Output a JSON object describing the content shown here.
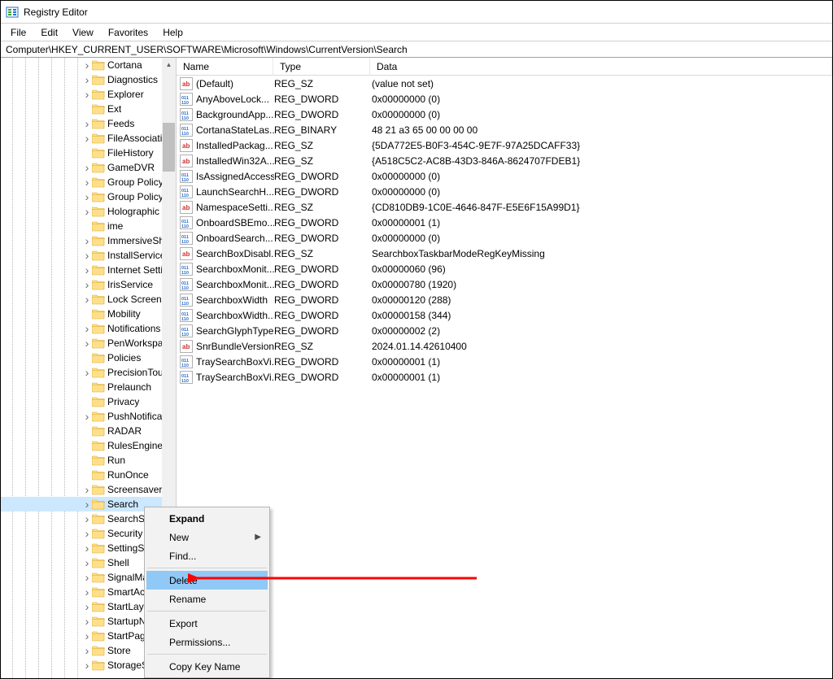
{
  "title": "Registry Editor",
  "menus": {
    "file": "File",
    "edit": "Edit",
    "view": "View",
    "favorites": "Favorites",
    "help": "Help"
  },
  "address": "Computer\\HKEY_CURRENT_USER\\SOFTWARE\\Microsoft\\Windows\\CurrentVersion\\Search",
  "columns": {
    "name": "Name",
    "type": "Type",
    "data": "Data"
  },
  "tree": [
    {
      "label": "Cortana",
      "exp": true,
      "depth": 6
    },
    {
      "label": "Diagnostics",
      "exp": true,
      "depth": 6
    },
    {
      "label": "Explorer",
      "exp": true,
      "depth": 6
    },
    {
      "label": "Ext",
      "exp": false,
      "depth": 6
    },
    {
      "label": "Feeds",
      "exp": true,
      "depth": 6
    },
    {
      "label": "FileAssociations",
      "exp": true,
      "depth": 6
    },
    {
      "label": "FileHistory",
      "exp": false,
      "depth": 6
    },
    {
      "label": "GameDVR",
      "exp": true,
      "depth": 6
    },
    {
      "label": "Group Policy",
      "exp": true,
      "depth": 6
    },
    {
      "label": "Group Policy",
      "exp": true,
      "depth": 6
    },
    {
      "label": "Holographic",
      "exp": true,
      "depth": 6
    },
    {
      "label": "ime",
      "exp": false,
      "depth": 6
    },
    {
      "label": "ImmersiveShell",
      "exp": true,
      "depth": 6
    },
    {
      "label": "InstallService",
      "exp": true,
      "depth": 6
    },
    {
      "label": "Internet Settings",
      "exp": true,
      "depth": 6
    },
    {
      "label": "IrisService",
      "exp": true,
      "depth": 6
    },
    {
      "label": "Lock Screen",
      "exp": true,
      "depth": 6
    },
    {
      "label": "Mobility",
      "exp": false,
      "depth": 6
    },
    {
      "label": "Notifications",
      "exp": true,
      "depth": 6
    },
    {
      "label": "PenWorkspace",
      "exp": true,
      "depth": 6
    },
    {
      "label": "Policies",
      "exp": false,
      "depth": 6
    },
    {
      "label": "PrecisionTouchPad",
      "exp": true,
      "depth": 6
    },
    {
      "label": "Prelaunch",
      "exp": false,
      "depth": 6
    },
    {
      "label": "Privacy",
      "exp": false,
      "depth": 6
    },
    {
      "label": "PushNotifications",
      "exp": true,
      "depth": 6
    },
    {
      "label": "RADAR",
      "exp": false,
      "depth": 6
    },
    {
      "label": "RulesEngine",
      "exp": false,
      "depth": 6
    },
    {
      "label": "Run",
      "exp": false,
      "depth": 6
    },
    {
      "label": "RunOnce",
      "exp": false,
      "depth": 6
    },
    {
      "label": "Screensavers",
      "exp": true,
      "depth": 6
    },
    {
      "label": "Search",
      "exp": true,
      "depth": 6,
      "selected": true
    },
    {
      "label": "SearchSettings",
      "exp": true,
      "depth": 6
    },
    {
      "label": "Security",
      "exp": true,
      "depth": 6
    },
    {
      "label": "SettingSync",
      "exp": true,
      "depth": 6
    },
    {
      "label": "Shell",
      "exp": true,
      "depth": 6
    },
    {
      "label": "SignalManager",
      "exp": true,
      "depth": 6
    },
    {
      "label": "SmartActionPlatform",
      "exp": true,
      "depth": 6
    },
    {
      "label": "StartLayout",
      "exp": true,
      "depth": 6
    },
    {
      "label": "StartupNotify",
      "exp": true,
      "depth": 6
    },
    {
      "label": "StartPage",
      "exp": true,
      "depth": 6
    },
    {
      "label": "Store",
      "exp": true,
      "depth": 6
    },
    {
      "label": "StorageSense",
      "exp": true,
      "depth": 6
    }
  ],
  "values": [
    {
      "icon": "sz",
      "name": "(Default)",
      "type": "REG_SZ",
      "data": "(value not set)"
    },
    {
      "icon": "dw",
      "name": "AnyAboveLock...",
      "type": "REG_DWORD",
      "data": "0x00000000 (0)"
    },
    {
      "icon": "dw",
      "name": "BackgroundApp...",
      "type": "REG_DWORD",
      "data": "0x00000000 (0)"
    },
    {
      "icon": "dw",
      "name": "CortanaStateLas...",
      "type": "REG_BINARY",
      "data": "48 21 a3 65 00 00 00 00"
    },
    {
      "icon": "sz",
      "name": "InstalledPackag...",
      "type": "REG_SZ",
      "data": "{5DA772E5-B0F3-454C-9E7F-97A25DCAFF33}"
    },
    {
      "icon": "sz",
      "name": "InstalledWin32A...",
      "type": "REG_SZ",
      "data": "{A518C5C2-AC8B-43D3-846A-8624707FDEB1}"
    },
    {
      "icon": "dw",
      "name": "IsAssignedAccess",
      "type": "REG_DWORD",
      "data": "0x00000000 (0)"
    },
    {
      "icon": "dw",
      "name": "LaunchSearchH...",
      "type": "REG_DWORD",
      "data": "0x00000000 (0)"
    },
    {
      "icon": "sz",
      "name": "NamespaceSetti...",
      "type": "REG_SZ",
      "data": "{CD810DB9-1C0E-4646-847F-E5E6F15A99D1}"
    },
    {
      "icon": "dw",
      "name": "OnboardSBEmo...",
      "type": "REG_DWORD",
      "data": "0x00000001 (1)"
    },
    {
      "icon": "dw",
      "name": "OnboardSearch...",
      "type": "REG_DWORD",
      "data": "0x00000000 (0)"
    },
    {
      "icon": "sz",
      "name": "SearchBoxDisabl...",
      "type": "REG_SZ",
      "data": "SearchboxTaskbarModeRegKeyMissing"
    },
    {
      "icon": "dw",
      "name": "SearchboxMonit...",
      "type": "REG_DWORD",
      "data": "0x00000060 (96)"
    },
    {
      "icon": "dw",
      "name": "SearchboxMonit...",
      "type": "REG_DWORD",
      "data": "0x00000780 (1920)"
    },
    {
      "icon": "dw",
      "name": "SearchboxWidth",
      "type": "REG_DWORD",
      "data": "0x00000120 (288)"
    },
    {
      "icon": "dw",
      "name": "SearchboxWidth...",
      "type": "REG_DWORD",
      "data": "0x00000158 (344)"
    },
    {
      "icon": "dw",
      "name": "SearchGlyphType",
      "type": "REG_DWORD",
      "data": "0x00000002 (2)"
    },
    {
      "icon": "sz",
      "name": "SnrBundleVersion",
      "type": "REG_SZ",
      "data": "2024.01.14.42610400"
    },
    {
      "icon": "dw",
      "name": "TraySearchBoxVi...",
      "type": "REG_DWORD",
      "data": "0x00000001 (1)"
    },
    {
      "icon": "dw",
      "name": "TraySearchBoxVi...",
      "type": "REG_DWORD",
      "data": "0x00000001 (1)"
    }
  ],
  "contextMenu": {
    "expand": "Expand",
    "new": "New",
    "find": "Find...",
    "delete": "Delete",
    "rename": "Rename",
    "export": "Export",
    "permissions": "Permissions...",
    "copyKeyName": "Copy Key Name"
  }
}
